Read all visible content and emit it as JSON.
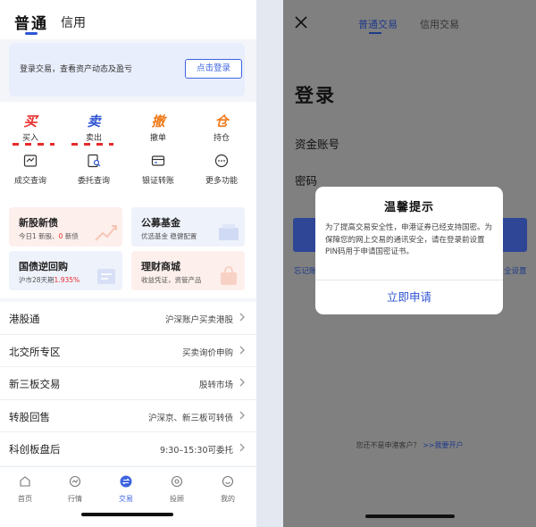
{
  "left": {
    "tabs": {
      "main": "普通",
      "credit": "信用"
    },
    "login_card": {
      "text": "登录交易，查看资产动态及盈亏",
      "button": "点击登录"
    },
    "quick_actions": [
      {
        "glyph": "买",
        "label": "买入",
        "color": "#e72b2b"
      },
      {
        "glyph": "卖",
        "label": "卖出",
        "color": "#2f55d4"
      },
      {
        "glyph": "撤",
        "label": "撤单",
        "color": "#f07a1a"
      },
      {
        "glyph": "仓",
        "label": "持仓",
        "color": "#f07a1a"
      }
    ],
    "functions": [
      {
        "label": "成交查询",
        "icon": "deal-query-icon"
      },
      {
        "label": "委托查询",
        "icon": "order-query-icon"
      },
      {
        "label": "银证转账",
        "icon": "bank-transfer-icon"
      },
      {
        "label": "更多功能",
        "icon": "more-icon"
      }
    ],
    "cards": [
      {
        "title": "新股新债",
        "sub_prefix": "今日1 新股、",
        "sub_red": "0",
        "sub_suffix": " 新债",
        "bg": "#fdf0ec"
      },
      {
        "title": "公募基金",
        "sub_prefix": "优选基金 稳健配置",
        "sub_red": "",
        "sub_suffix": "",
        "bg": "#eef2fb"
      },
      {
        "title": "国债逆回购",
        "sub_prefix": "沪市28天期",
        "sub_red": "1.935%",
        "sub_suffix": "",
        "bg": "#eef2fb"
      },
      {
        "title": "理财商城",
        "sub_prefix": "收益凭证，资管产品",
        "sub_red": "",
        "sub_suffix": "",
        "bg": "#fdf0ec"
      }
    ],
    "rows": [
      {
        "left": "港股通",
        "right": "沪深账户买卖港股"
      },
      {
        "left": "北交所专区",
        "right": "买卖询价申购"
      },
      {
        "left": "新三板交易",
        "right": "股转市场"
      },
      {
        "left": "转股回售",
        "right": "沪深京、新三板可转债"
      },
      {
        "left": "科创板盘后",
        "right": "9:30–15:30可委托"
      }
    ],
    "nav": [
      {
        "label": "首页",
        "icon": "home-icon"
      },
      {
        "label": "行情",
        "icon": "market-icon"
      },
      {
        "label": "交易",
        "icon": "trade-icon",
        "active": true
      },
      {
        "label": "投顾",
        "icon": "advisor-icon"
      },
      {
        "label": "我的",
        "icon": "profile-icon"
      }
    ]
  },
  "right": {
    "tabs": {
      "normal": "普通交易",
      "credit": "信用交易"
    },
    "title": "登录",
    "account_label": "资金账号",
    "password_label": "密码",
    "forgot_fragment": "忘记账",
    "setup_fragment": "全设置",
    "bottom_text": "您还不是申港客户？",
    "bottom_link": ">>我要开户",
    "dialog": {
      "title": "温馨提示",
      "body": "为了提高交易安全性，申港证券已经支持国密。为保障您的网上交易的通讯安全，请在登录前设置PIN码用于申请国密证书。",
      "button": "立即申请"
    }
  },
  "colors": {
    "accent": "#3d64e0",
    "red": "#e72b2b",
    "orange": "#f07a1a",
    "overlay_gray": "#808080"
  }
}
